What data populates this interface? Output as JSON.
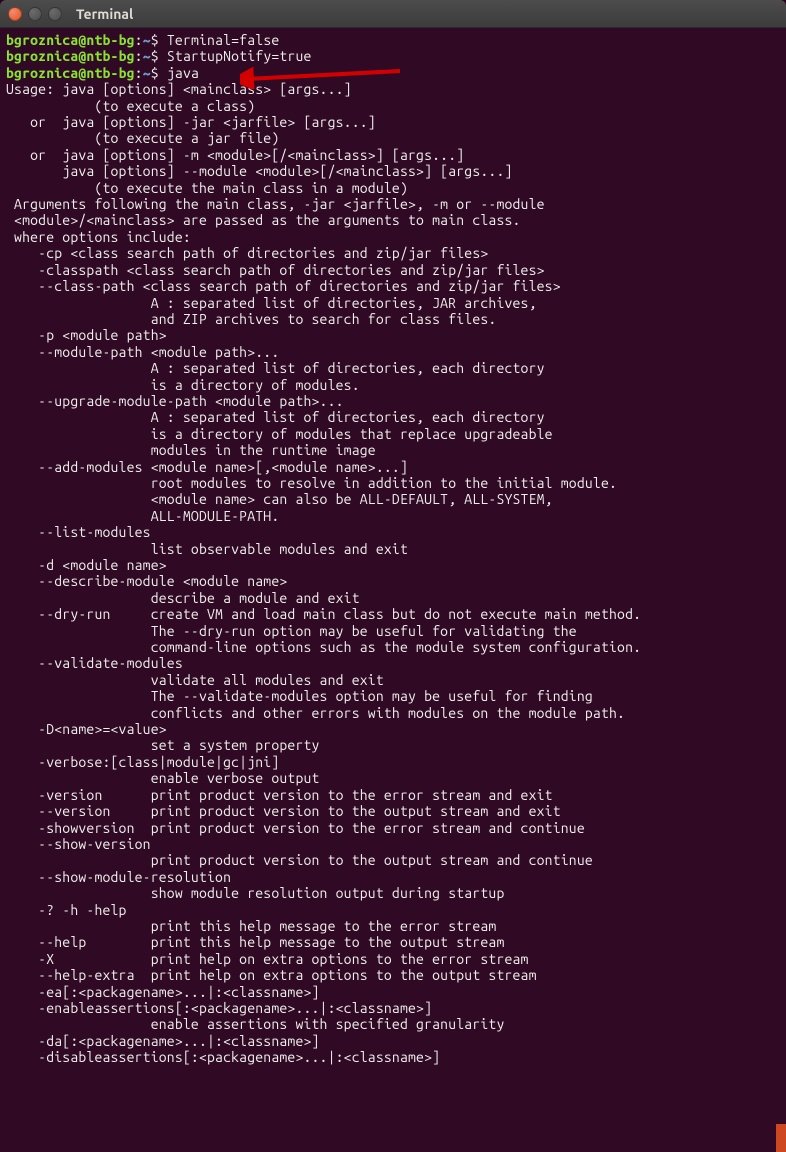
{
  "titlebar": {
    "title": "Terminal"
  },
  "prompt": {
    "user": "bgroznica",
    "at": "@",
    "host": "ntb-bg",
    "colon": ":",
    "path": "~",
    "dollar": "$ "
  },
  "lines": [
    {
      "type": "prompt",
      "cmd": "Terminal=false"
    },
    {
      "type": "prompt",
      "cmd": "StartupNotify=true"
    },
    {
      "type": "prompt",
      "cmd": "java"
    },
    {
      "type": "out",
      "text": "Usage: java [options] <mainclass> [args...]"
    },
    {
      "type": "out",
      "text": "           (to execute a class)"
    },
    {
      "type": "out",
      "text": "   or  java [options] -jar <jarfile> [args...]"
    },
    {
      "type": "out",
      "text": "           (to execute a jar file)"
    },
    {
      "type": "out",
      "text": "   or  java [options] -m <module>[/<mainclass>] [args...]"
    },
    {
      "type": "out",
      "text": "       java [options] --module <module>[/<mainclass>] [args...]"
    },
    {
      "type": "out",
      "text": "           (to execute the main class in a module)"
    },
    {
      "type": "out",
      "text": ""
    },
    {
      "type": "out",
      "text": " Arguments following the main class, -jar <jarfile>, -m or --module"
    },
    {
      "type": "out",
      "text": " <module>/<mainclass> are passed as the arguments to main class."
    },
    {
      "type": "out",
      "text": ""
    },
    {
      "type": "out",
      "text": " where options include:"
    },
    {
      "type": "out",
      "text": ""
    },
    {
      "type": "out",
      "text": "    -cp <class search path of directories and zip/jar files>"
    },
    {
      "type": "out",
      "text": "    -classpath <class search path of directories and zip/jar files>"
    },
    {
      "type": "out",
      "text": "    --class-path <class search path of directories and zip/jar files>"
    },
    {
      "type": "out",
      "text": "                  A : separated list of directories, JAR archives,"
    },
    {
      "type": "out",
      "text": "                  and ZIP archives to search for class files."
    },
    {
      "type": "out",
      "text": "    -p <module path>"
    },
    {
      "type": "out",
      "text": "    --module-path <module path>..."
    },
    {
      "type": "out",
      "text": "                  A : separated list of directories, each directory"
    },
    {
      "type": "out",
      "text": "                  is a directory of modules."
    },
    {
      "type": "out",
      "text": "    --upgrade-module-path <module path>..."
    },
    {
      "type": "out",
      "text": "                  A : separated list of directories, each directory"
    },
    {
      "type": "out",
      "text": "                  is a directory of modules that replace upgradeable"
    },
    {
      "type": "out",
      "text": "                  modules in the runtime image"
    },
    {
      "type": "out",
      "text": "    --add-modules <module name>[,<module name>...]"
    },
    {
      "type": "out",
      "text": "                  root modules to resolve in addition to the initial module."
    },
    {
      "type": "out",
      "text": "                  <module name> can also be ALL-DEFAULT, ALL-SYSTEM,"
    },
    {
      "type": "out",
      "text": "                  ALL-MODULE-PATH."
    },
    {
      "type": "out",
      "text": "    --list-modules"
    },
    {
      "type": "out",
      "text": "                  list observable modules and exit"
    },
    {
      "type": "out",
      "text": "    -d <module name>"
    },
    {
      "type": "out",
      "text": "    --describe-module <module name>"
    },
    {
      "type": "out",
      "text": "                  describe a module and exit"
    },
    {
      "type": "out",
      "text": "    --dry-run     create VM and load main class but do not execute main method."
    },
    {
      "type": "out",
      "text": "                  The --dry-run option may be useful for validating the"
    },
    {
      "type": "out",
      "text": "                  command-line options such as the module system configuration."
    },
    {
      "type": "out",
      "text": "    --validate-modules"
    },
    {
      "type": "out",
      "text": "                  validate all modules and exit"
    },
    {
      "type": "out",
      "text": "                  The --validate-modules option may be useful for finding"
    },
    {
      "type": "out",
      "text": "                  conflicts and other errors with modules on the module path."
    },
    {
      "type": "out",
      "text": "    -D<name>=<value>"
    },
    {
      "type": "out",
      "text": "                  set a system property"
    },
    {
      "type": "out",
      "text": "    -verbose:[class|module|gc|jni]"
    },
    {
      "type": "out",
      "text": "                  enable verbose output"
    },
    {
      "type": "out",
      "text": "    -version      print product version to the error stream and exit"
    },
    {
      "type": "out",
      "text": "    --version     print product version to the output stream and exit"
    },
    {
      "type": "out",
      "text": "    -showversion  print product version to the error stream and continue"
    },
    {
      "type": "out",
      "text": "    --show-version"
    },
    {
      "type": "out",
      "text": "                  print product version to the output stream and continue"
    },
    {
      "type": "out",
      "text": "    --show-module-resolution"
    },
    {
      "type": "out",
      "text": "                  show module resolution output during startup"
    },
    {
      "type": "out",
      "text": "    -? -h -help"
    },
    {
      "type": "out",
      "text": "                  print this help message to the error stream"
    },
    {
      "type": "out",
      "text": "    --help        print this help message to the output stream"
    },
    {
      "type": "out",
      "text": "    -X            print help on extra options to the error stream"
    },
    {
      "type": "out",
      "text": "    --help-extra  print help on extra options to the output stream"
    },
    {
      "type": "out",
      "text": "    -ea[:<packagename>...|:<classname>]"
    },
    {
      "type": "out",
      "text": "    -enableassertions[:<packagename>...|:<classname>]"
    },
    {
      "type": "out",
      "text": "                  enable assertions with specified granularity"
    },
    {
      "type": "out",
      "text": "    -da[:<packagename>...|:<classname>]"
    },
    {
      "type": "out",
      "text": "    -disableassertions[:<packagename>...|:<classname>]"
    }
  ]
}
